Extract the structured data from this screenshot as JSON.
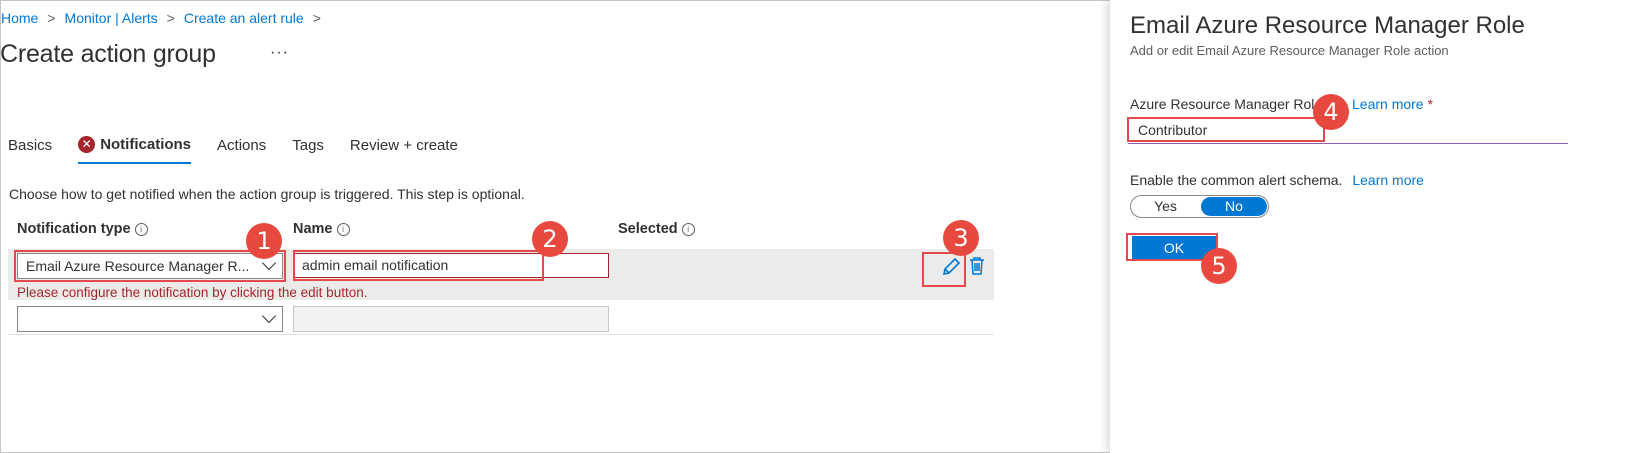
{
  "breadcrumb": [
    "Home",
    "Monitor | Alerts",
    "Create an alert rule"
  ],
  "page_title": "Create action group",
  "more_label": "···",
  "tabs": [
    {
      "label": "Basics"
    },
    {
      "label": "Notifications",
      "active": true,
      "error": true
    },
    {
      "label": "Actions"
    },
    {
      "label": "Tags"
    },
    {
      "label": "Review + create"
    }
  ],
  "description": "Choose how to get notified when the action group is triggered. This step is optional.",
  "columns": {
    "type": "Notification type",
    "name": "Name",
    "selected": "Selected"
  },
  "rows": [
    {
      "type": "Email Azure Resource Manager R...",
      "name": "admin email notification",
      "error": "Please configure the notification by clicking the edit button."
    },
    {
      "type": "",
      "name": ""
    }
  ],
  "panel": {
    "title": "Email Azure Resource Manager Role",
    "subtitle": "Add or edit Email Azure Resource Manager Role action",
    "role_label": "Azure Resource Manager Role",
    "learn_more": "Learn more",
    "required_mark": "*",
    "role_value": "Contributor",
    "schema_label": "Enable the common alert schema.",
    "toggle_yes": "Yes",
    "toggle_no": "No",
    "toggle_selected": "No",
    "ok_label": "OK"
  },
  "badges": [
    "1",
    "2",
    "3",
    "4",
    "5"
  ],
  "colors": {
    "accent": "#0078d4",
    "error": "#a4262c",
    "highlight": "#e5484d",
    "badge": "#e8493f"
  },
  "icons": {
    "edit": "pencil-icon",
    "delete": "trash-icon",
    "info": "info-icon",
    "error": "error-circle-icon",
    "dropdown": "chevron-down-icon"
  }
}
